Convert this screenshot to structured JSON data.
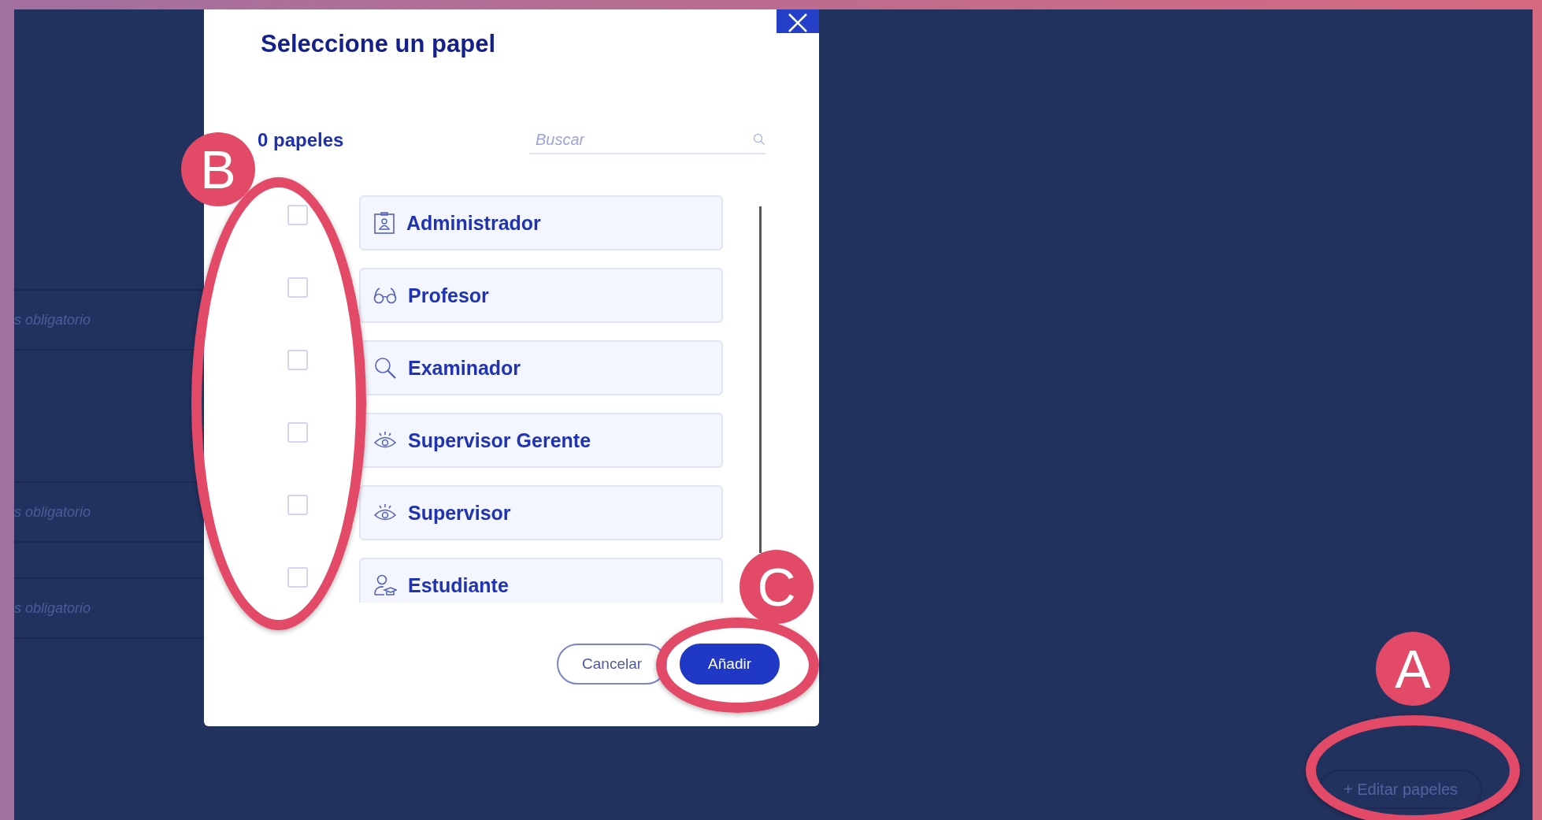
{
  "background": {
    "rows": [
      {
        "text": "s obligatorio"
      },
      {
        "text": "s obligatorio"
      },
      {
        "text": "s obligatorio"
      }
    ],
    "edit_button": {
      "label": "+ Editar papeles"
    }
  },
  "dialog": {
    "title": "Seleccione un papel",
    "count": "0 papeles",
    "search": {
      "placeholder": "Buscar"
    },
    "roles": [
      {
        "kind": "badge",
        "label": "Administrador",
        "checked": false
      },
      {
        "kind": "glasses",
        "label": "Profesor",
        "checked": false
      },
      {
        "kind": "magnifier",
        "label": "Examinador",
        "checked": false
      },
      {
        "kind": "eye",
        "label": "Supervisor Gerente",
        "checked": false
      },
      {
        "kind": "eye",
        "label": "Supervisor",
        "checked": false
      },
      {
        "kind": "student",
        "label": "Estudiante",
        "checked": false
      }
    ],
    "buttons": [
      {
        "kind": "secondary",
        "label": "Cancelar"
      },
      {
        "kind": "primary",
        "label": "Añadir"
      }
    ]
  },
  "annotations": [
    {
      "label": "B"
    },
    {
      "label": "C"
    },
    {
      "label": "A"
    }
  ]
}
